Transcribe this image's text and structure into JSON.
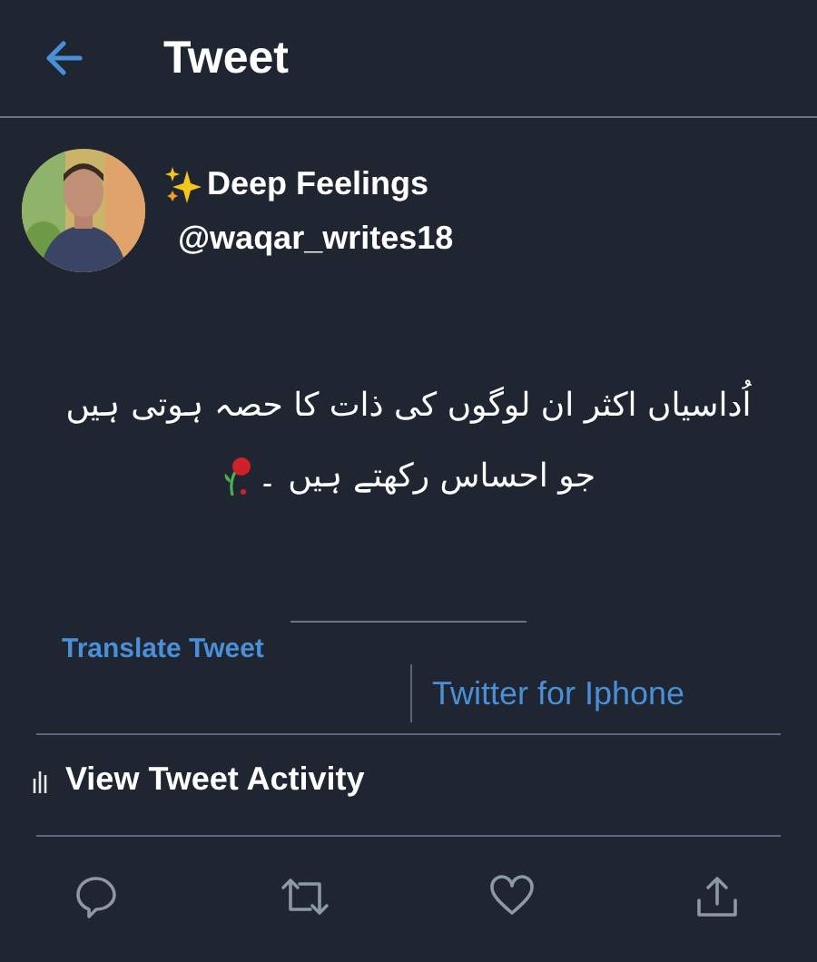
{
  "header": {
    "title": "Tweet"
  },
  "author": {
    "display_name": "Deep Feelings",
    "handle": "@waqar_writes18"
  },
  "tweet": {
    "lines": [
      "اُداسیاں اکثر ان لوگوں کی ذات کا حصہ ہوتی ہیں",
      "جو احساس رکھتے ہیں ۔"
    ]
  },
  "translate_link": "Translate Tweet",
  "source": "Twitter for Iphone",
  "activity_link": "View Tweet Activity"
}
